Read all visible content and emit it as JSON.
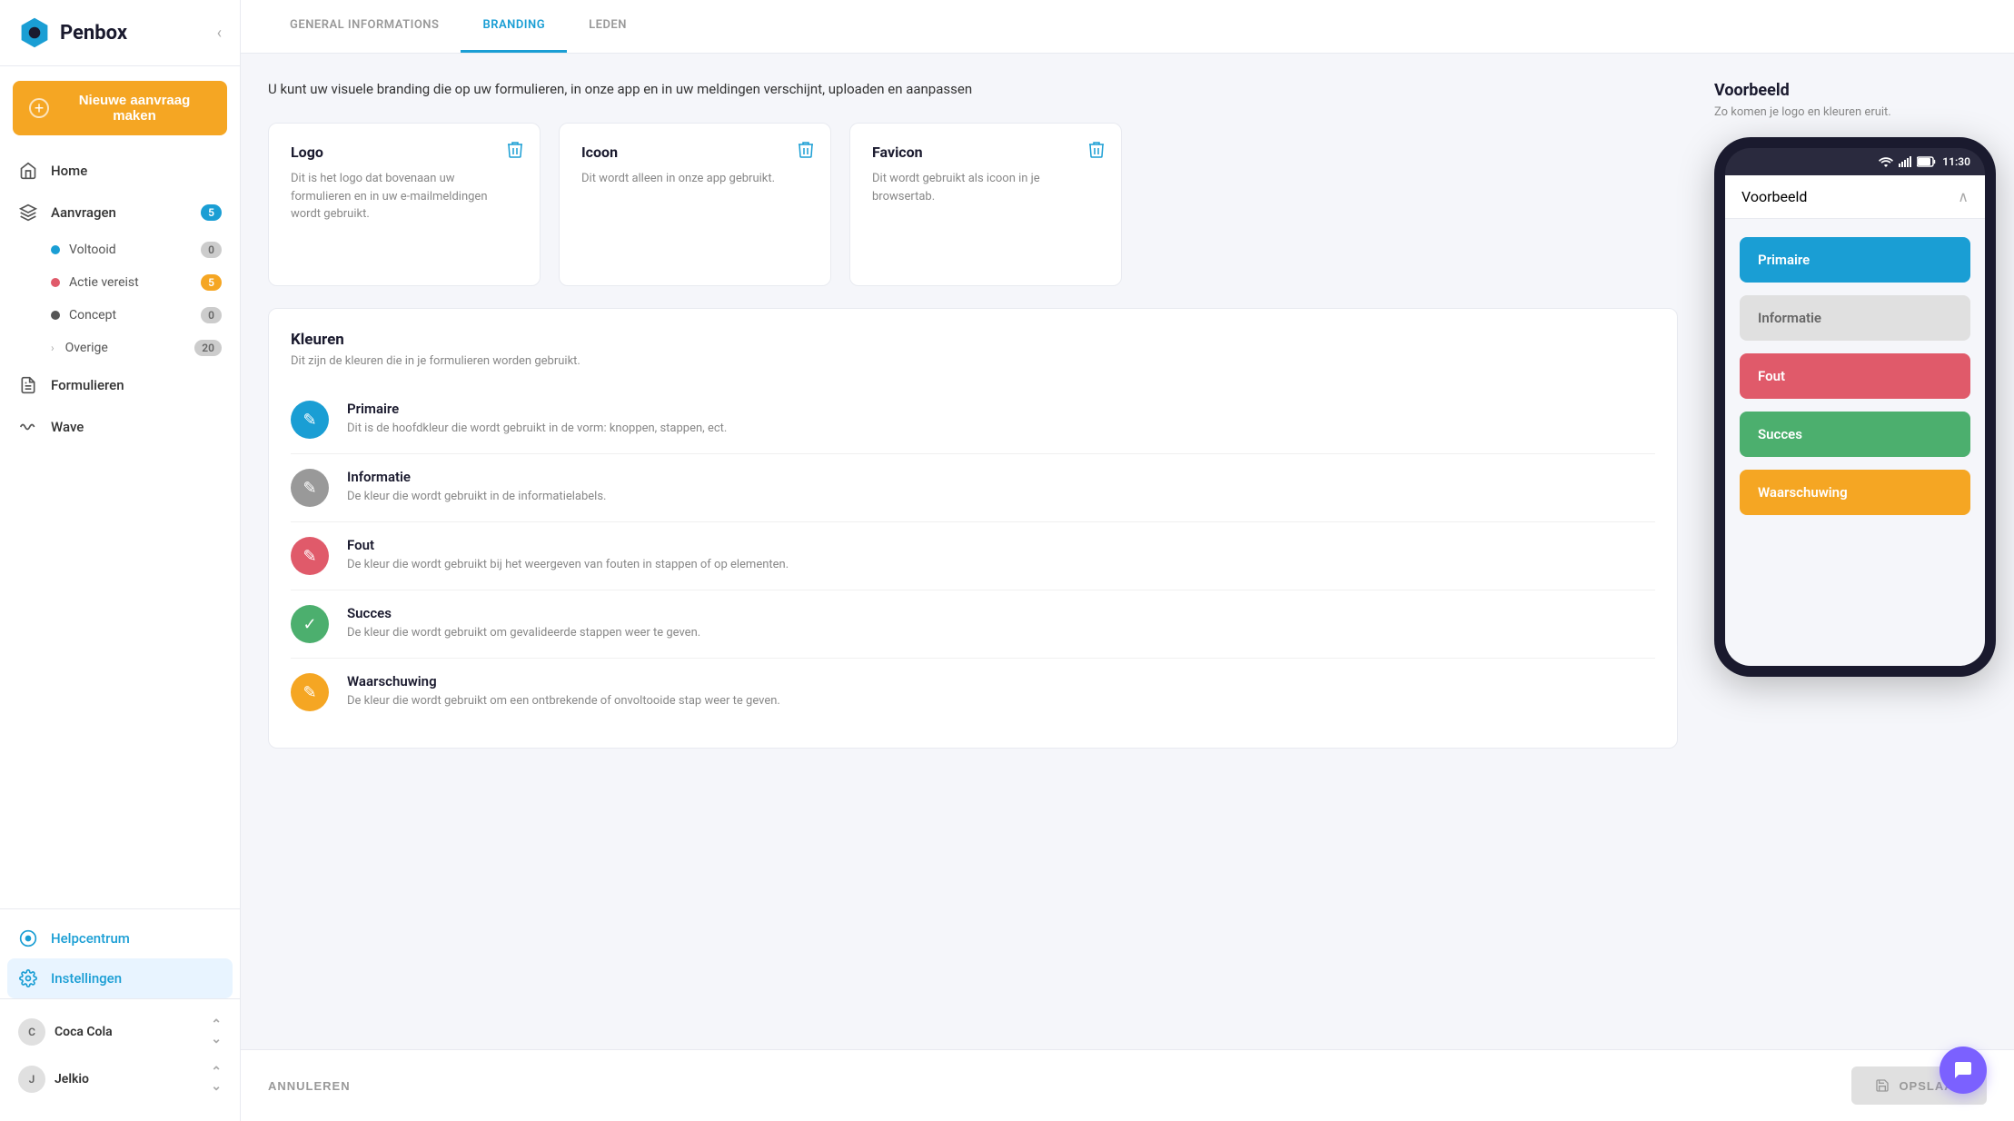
{
  "app": {
    "name": "Penbox"
  },
  "sidebar": {
    "collapse_label": "‹",
    "new_request_label": "Nieuwe aanvraag maken",
    "nav": [
      {
        "id": "home",
        "label": "Home",
        "icon": "home-icon",
        "badge": null
      },
      {
        "id": "aanvragen",
        "label": "Aanvragen",
        "icon": "layers-icon",
        "badge": "5",
        "badge_type": "blue"
      }
    ],
    "sub_nav": [
      {
        "id": "voltooid",
        "label": "Voltooid",
        "dot_color": "#1a9ed4",
        "badge": "0",
        "badge_type": "gray"
      },
      {
        "id": "actie-vereist",
        "label": "Actie vereist",
        "dot_color": "#e05a6a",
        "badge": "5",
        "badge_type": "orange"
      },
      {
        "id": "concept",
        "label": "Concept",
        "dot_color": "#555",
        "badge": "0",
        "badge_type": "gray"
      },
      {
        "id": "overige",
        "label": "Overige",
        "dot_color": null,
        "badge": "20",
        "badge_type": "gray",
        "has_chevron": true
      }
    ],
    "nav2": [
      {
        "id": "formulieren",
        "label": "Formulieren",
        "icon": "file-icon"
      },
      {
        "id": "wave",
        "label": "Wave",
        "icon": "wave-icon"
      }
    ],
    "bottom": [
      {
        "id": "helpcentrum",
        "label": "Helpcentrum",
        "icon": "help-icon"
      },
      {
        "id": "instellingen",
        "label": "Instellingen",
        "icon": "settings-icon",
        "active": true
      }
    ],
    "companies": [
      {
        "id": "coca-cola",
        "label": "Coca Cola",
        "has_chevron": true
      },
      {
        "id": "jelkio",
        "label": "Jelkio",
        "has_chevron": true
      }
    ]
  },
  "tabs": [
    {
      "id": "general",
      "label": "GENERAL INFORMATIONS",
      "active": false
    },
    {
      "id": "branding",
      "label": "BRANDING",
      "active": true
    },
    {
      "id": "leden",
      "label": "LEDEN",
      "active": false
    }
  ],
  "page": {
    "description": "U kunt uw visuele branding die op uw formulieren, in onze app en in uw meldingen verschijnt, uploaden en aanpassen"
  },
  "upload_cards": [
    {
      "id": "logo",
      "title": "Logo",
      "description": "Dit is het logo dat bovenaan uw formulieren en in uw e-mailmeldingen wordt gebruikt.",
      "has_delete": true
    },
    {
      "id": "icoon",
      "title": "Icoon",
      "description": "Dit wordt alleen in onze app gebruikt.",
      "has_delete": true
    },
    {
      "id": "favicon",
      "title": "Favicon",
      "description": "Dit wordt gebruikt als icoon in je browsertab.",
      "has_delete": true
    }
  ],
  "preview": {
    "title": "Voorbeeld",
    "subtitle": "Zo komen je logo en kleuren eruit.",
    "phone_time": "11:30",
    "phone_header": "Voorbeeld",
    "color_buttons": [
      {
        "id": "primaire",
        "label": "Primaire",
        "class": "primaire"
      },
      {
        "id": "informatie",
        "label": "Informatie",
        "class": "informatie"
      },
      {
        "id": "fout",
        "label": "Fout",
        "class": "fout"
      },
      {
        "id": "succes",
        "label": "Succes",
        "class": "succes"
      },
      {
        "id": "waarschuwing",
        "label": "Waarschuwing",
        "class": "waarschuwing"
      }
    ]
  },
  "colors_section": {
    "title": "Kleuren",
    "description": "Dit zijn de kleuren die in je formulieren worden gebruikt.",
    "colors": [
      {
        "id": "primaire",
        "name": "Primaire",
        "description": "Dit is de hoofdkleur die wordt gebruikt in de vorm: knoppen, stappen, ect.",
        "swatch_color": "#1a9ed4",
        "icon": "✎"
      },
      {
        "id": "informatie",
        "name": "Informatie",
        "description": "De kleur die wordt gebruikt in de informatielabels.",
        "swatch_color": "#999",
        "icon": "✎"
      },
      {
        "id": "fout",
        "name": "Fout",
        "description": "De kleur die wordt gebruikt bij het weergeven van fouten in stappen of op elementen.",
        "swatch_color": "#e05a6a",
        "icon": "✎"
      },
      {
        "id": "succes",
        "name": "Succes",
        "description": "De kleur die wordt gebruikt om gevalideerde stappen weer te geven.",
        "swatch_color": "#4caf6e",
        "icon": "✓"
      },
      {
        "id": "waarschuwing",
        "name": "Waarschuwing",
        "description": "De kleur die wordt gebruikt om een ontbrekende of onvoltooide stap weer te geven.",
        "swatch_color": "#f5a623",
        "icon": "✎"
      }
    ]
  },
  "footer": {
    "annuleren": "ANNULEREN",
    "opslaan": "OPSLAAN"
  }
}
